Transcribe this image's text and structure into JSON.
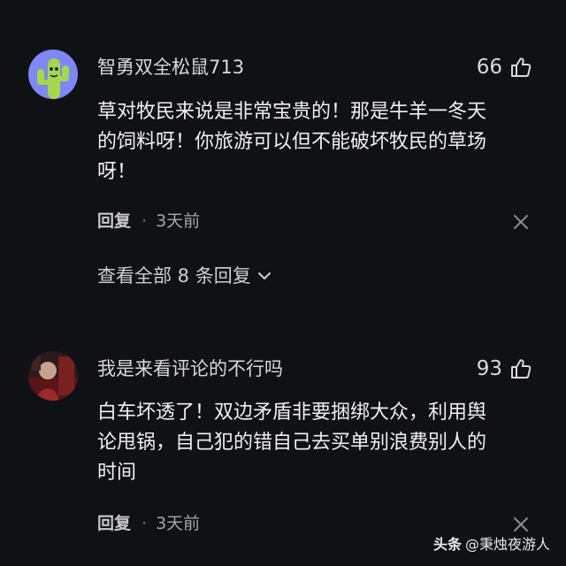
{
  "comments": [
    {
      "username": "智勇双全松鼠713",
      "likes": "66",
      "text": "草对牧民来说是非常宝贵的！那是牛羊一冬天\n的饲料呀！你旅游可以但不能破坏牧民的草场\n呀！",
      "reply_label": "回复",
      "time": "3天前",
      "avatar_icon": "cactus-avatar"
    },
    {
      "username": "我是来看评论的不行吗",
      "likes": "93",
      "text": "白车坏透了！双边矛盾非要捆绑大众，利用舆\n论甩锅，自己犯的错自己去买单别浪费别人的\n时间",
      "reply_label": "回复",
      "time": "3天前",
      "avatar_icon": "photo-avatar"
    }
  ],
  "view_replies": {
    "label": "查看全部 8 条回复"
  },
  "watermark": {
    "brand": "头条",
    "account": "@秉烛夜游人"
  },
  "colors": {
    "background": "#101114",
    "text": "#f0f0f2",
    "muted": "#a5a5aa",
    "avatar1_bg": "#7f86f5",
    "avatar1_cactus": "#a4d94a"
  },
  "icons": [
    "thumb-up-icon",
    "close-icon",
    "chevron-down-icon",
    "separator-dot"
  ]
}
